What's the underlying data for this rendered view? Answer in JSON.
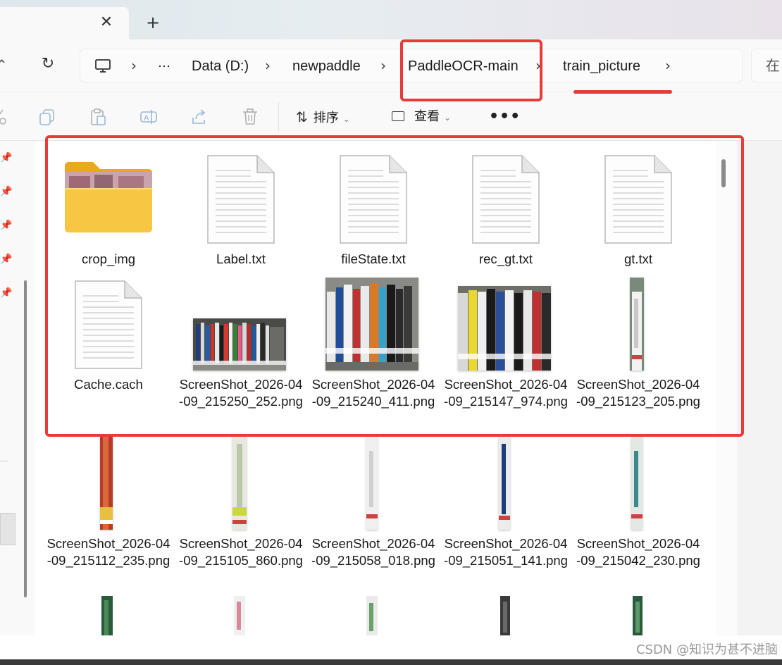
{
  "tab": {
    "close_glyph": "✕",
    "new_glyph": "+"
  },
  "nav": {
    "refresh_glyph": "↻"
  },
  "breadcrumb": {
    "more": "⋯",
    "sep": "›",
    "items": [
      "Data (D:)",
      "newpaddle",
      "PaddleOCR-main",
      "train_picture"
    ]
  },
  "search": {
    "placeholder": "在"
  },
  "toolbar": {
    "sort_label": "排序",
    "view_label": "查看",
    "more_glyph": "•••"
  },
  "files": [
    {
      "name": "crop_img",
      "type": "folder"
    },
    {
      "name": "Label.txt",
      "type": "text"
    },
    {
      "name": "fileState.txt",
      "type": "text"
    },
    {
      "name": "rec_gt.txt",
      "type": "text"
    },
    {
      "name": "gt.txt",
      "type": "text"
    },
    {
      "name": "Cache.cach",
      "type": "text"
    },
    {
      "name": "ScreenShot_2026-04-09_215250_252.png",
      "type": "image"
    },
    {
      "name": "ScreenShot_2026-04-09_215240_411.png",
      "type": "image"
    },
    {
      "name": "ScreenShot_2026-04-09_215147_974.png",
      "type": "image"
    },
    {
      "name": "ScreenShot_2026-04-09_215123_205.png",
      "type": "image"
    },
    {
      "name": "ScreenShot_2026-04-09_215112_235.png",
      "type": "image"
    },
    {
      "name": "ScreenShot_2026-04-09_215105_860.png",
      "type": "image"
    },
    {
      "name": "ScreenShot_2026-04-09_215058_018.png",
      "type": "image"
    },
    {
      "name": "ScreenShot_2026-04-09_215051_141.png",
      "type": "image"
    },
    {
      "name": "ScreenShot_2026-04-09_215042_230.png",
      "type": "image"
    }
  ],
  "watermark": "CSDN @知识为甚不进脑",
  "colors": {
    "highlight": "#e83a3a",
    "folder": "#f5c242"
  }
}
